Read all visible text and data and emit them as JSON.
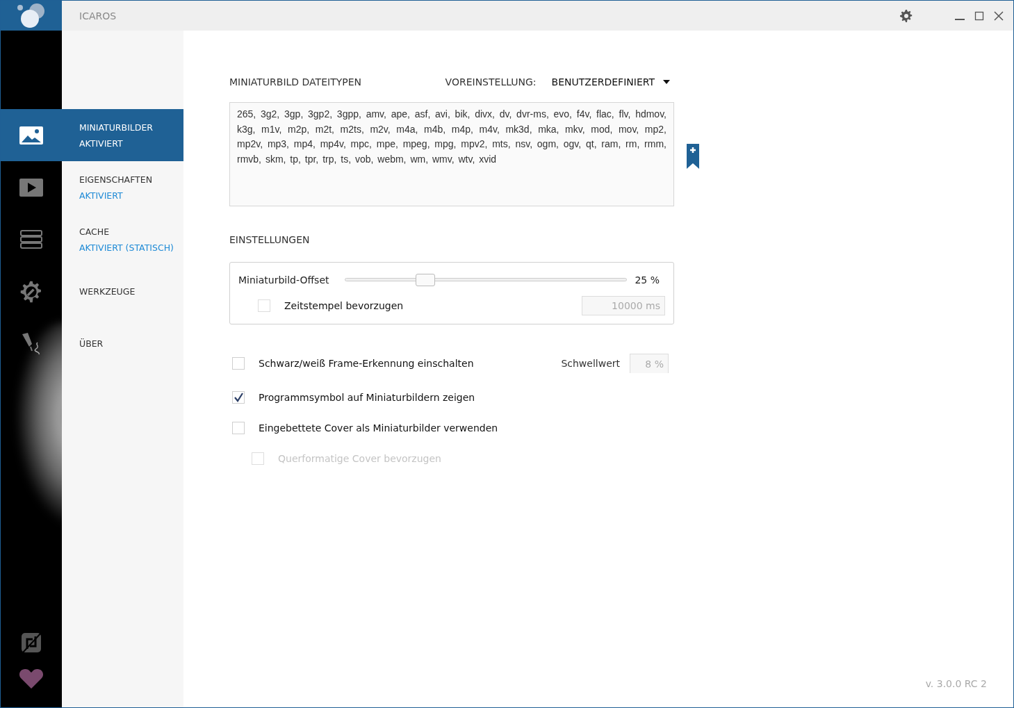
{
  "window": {
    "title": "ICAROS"
  },
  "nav": [
    {
      "title": "MINIATURBILDER",
      "status": "AKTIVIERT",
      "selected": true
    },
    {
      "title": "EIGENSCHAFTEN",
      "status": "AKTIVIERT",
      "selected": false
    },
    {
      "title": "CACHE",
      "status": "AKTIVIERT (STATISCH)",
      "selected": false
    },
    {
      "title": "WERKZEUGE",
      "selected": false
    },
    {
      "title": "ÜBER",
      "selected": false
    }
  ],
  "file_types": {
    "label": "MINIATURBILD DATEITYPEN",
    "preset_label": "VOREINSTELLUNG:",
    "preset_value": "BENUTZERDEFINIERT",
    "value": "265, 3g2, 3gp, 3gp2, 3gpp, amv, ape, asf, avi, bik, divx, dv, dvr-ms, evo, f4v, flac, flv, hdmov, k3g, m1v, m2p, m2t, m2ts, m2v, m4a, m4b, m4p, m4v, mk3d, mka, mkv, mod, mov, mp2, mp2v, mp3, mp4, mp4v, mpc, mpe, mpeg, mpg, mpv2, mts, nsv, ogm, ogv, qt, ram, rm, rmm, rmvb, skm, tp, tpr, trp, ts, vob, webm, wm, wmv, wtv, xvid"
  },
  "settings": {
    "heading": "EINSTELLUNGEN",
    "offset": {
      "label": "Miniaturbild-Offset",
      "level": 0.26,
      "reading": "25 %"
    },
    "timestamp": {
      "label": "Zeitstempel bevorzugen",
      "checked": false,
      "value": "10000 ms",
      "disabled": true
    }
  },
  "options": [
    {
      "label": "Schwarz/weiß Frame-Erkennung einschalten",
      "checked": false,
      "disabled": false,
      "threshold": {
        "label": "Schwellwert",
        "value": "8 %",
        "disabled": true
      }
    },
    {
      "label": "Programmsymbol auf Miniaturbildern zeigen",
      "checked": true,
      "disabled": false
    },
    {
      "label": "Eingebettete Cover als Miniaturbilder verwenden",
      "checked": false,
      "disabled": false,
      "children": [
        {
          "label": "Querformatige Cover bevorzugen",
          "checked": false,
          "disabled": true
        }
      ]
    }
  ],
  "version": "v. 3.0.0 RC 2"
}
